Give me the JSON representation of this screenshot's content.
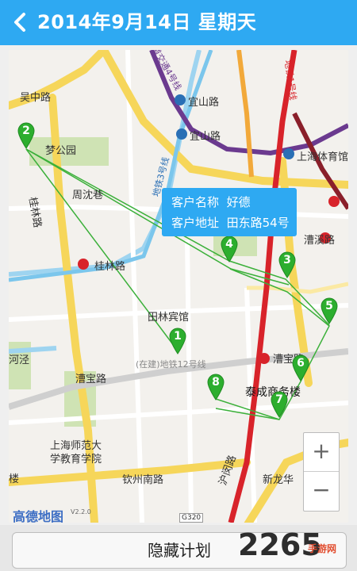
{
  "header": {
    "title": "2014年9月14日 星期天",
    "back_icon": "chevron-left-icon"
  },
  "map": {
    "labels": {
      "wuzhong_rd": "吴中路",
      "menggongyuan": "梦公园",
      "zhouchenxiang": "周沈巷",
      "guilin_rd_v": "桂林路",
      "guilin_rd_st": "桂林路",
      "tianlin_hotel": "田林宾馆",
      "yishan_rd_1": "宜山路",
      "yishan_rd_2": "宜山路",
      "shanghai_stadium": "上海体育馆",
      "caoxi_rd": "漕溪路",
      "caobao_rd": "漕宝路",
      "caobao_rd_st": "漕宝路",
      "taicheng_building": "泰成商务楼",
      "shnu_1": "上海师范大",
      "shnu_2": "学教育学院",
      "qinzhou_s_rd": "钦州南路",
      "humin_rd": "沪闵路",
      "xinlonghua": "新龙华",
      "hejing": "河泾",
      "lou": "楼",
      "line12": "(在建)地铁12号线",
      "line3": "地铁3号线",
      "line1": "地铁1号线",
      "line4": "轨道交通4号线",
      "g320": "G320"
    },
    "logo": "高德地图",
    "logo_version": "V2.2.0"
  },
  "pins": [
    "1",
    "2",
    "3",
    "4",
    "5",
    "6",
    "7",
    "8"
  ],
  "callout": {
    "name_label": "客户名称",
    "name_value": "好德",
    "address_label": "客户地址",
    "address_value": "田东路54号"
  },
  "zoom": {
    "in": "+",
    "out": "−"
  },
  "footer": {
    "hide_plan": "隐藏计划"
  },
  "watermark": {
    "text": "2265",
    "sub": "手游网"
  },
  "colors": {
    "accent": "#2ea9f2",
    "pin": "#2cae2e",
    "route": "#3bb03a",
    "metro_red": "#d8232a",
    "road_yellow": "#f6d65a"
  }
}
